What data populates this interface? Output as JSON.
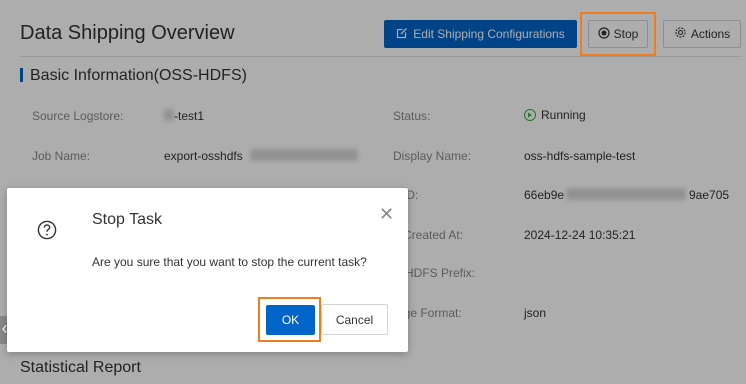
{
  "header": {
    "title": "Data Shipping Overview",
    "edit_label": "Edit Shipping Configurations",
    "stop_label": "Stop",
    "actions_label": "Actions"
  },
  "basic": {
    "section_title": "Basic Information(OSS-HDFS)",
    "source_logstore_label": "Source Logstore:",
    "source_logstore_value": "-test1",
    "job_name_label": "Job Name:",
    "job_name_value": "export-osshdfs",
    "status_label": "Status:",
    "status_value": "Running",
    "display_name_label": "Display Name:",
    "display_name_value": "oss-hdfs-sample-test",
    "id_label": "b ID:",
    "id_value_start": "66eb9e",
    "id_value_end": "9ae705",
    "created_label": "b Created At:",
    "created_value": "2024-12-24 10:35:21",
    "prefix_label": "S-HDFS Prefix:",
    "format_label": "rage Format:",
    "format_value": "json"
  },
  "stats": {
    "section_title": "Statistical Report"
  },
  "dialog": {
    "title": "Stop Task",
    "message": "Are you sure that you want to stop the current task?",
    "ok_label": "OK",
    "cancel_label": "Cancel",
    "close_glyph": "✕"
  },
  "colors": {
    "primary": "#0064c8",
    "highlight": "#f07c1e",
    "running": "#3cb043"
  },
  "icons": [
    "edit-icon",
    "stop-icon",
    "gear-icon",
    "running-icon",
    "question-icon",
    "close-icon"
  ]
}
